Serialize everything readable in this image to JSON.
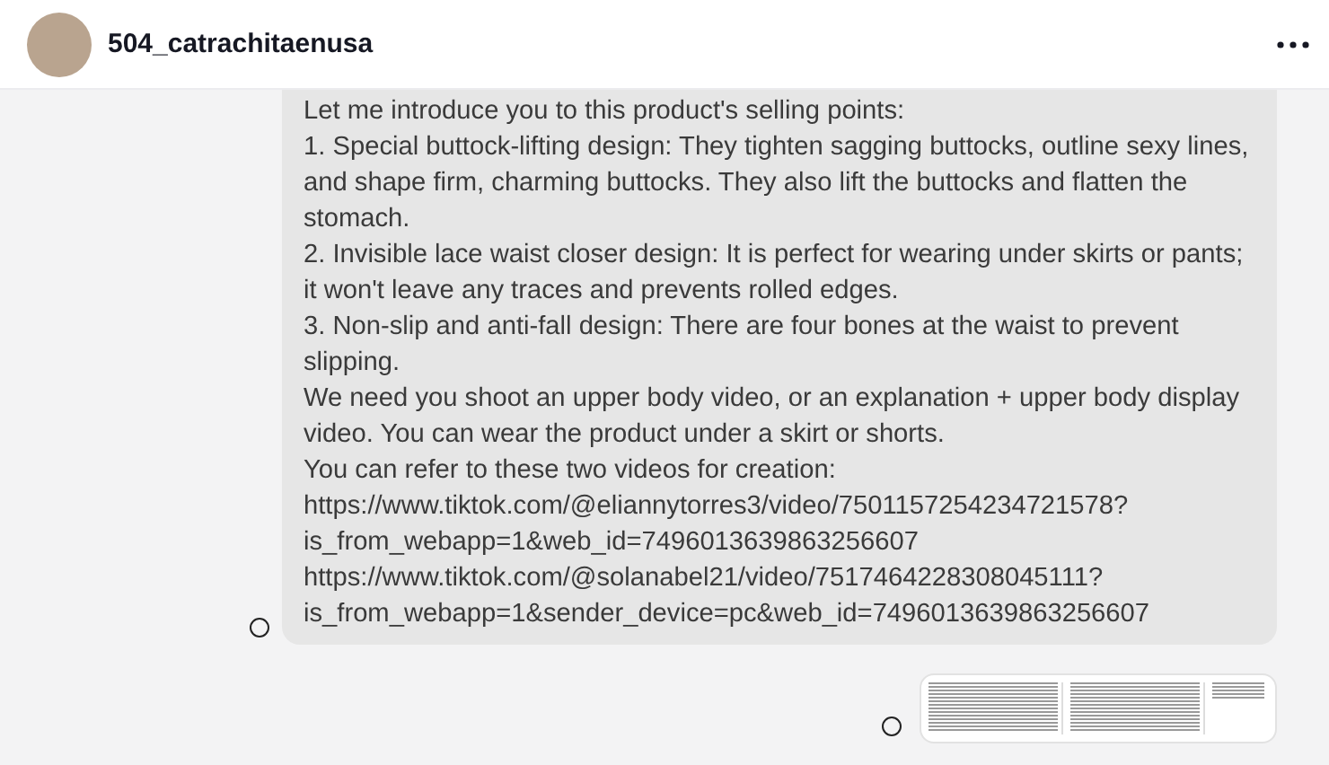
{
  "header": {
    "username": "504_catrachitaenusa"
  },
  "messages": [
    {
      "kind": "text",
      "selected": false,
      "paragraphs": [
        "Let me introduce you to this product's selling points:",
        "1. Special buttock-lifting design: They tighten sagging buttocks, outline sexy lines, and shape firm, charming buttocks. They also lift the buttocks and flatten the stomach.",
        "2. Invisible lace waist closer design: It is perfect for wearing under skirts or pants; it won't leave any traces and prevents rolled edges.",
        "3. Non-slip and anti-fall design: There are four bones at the waist to prevent slipping.",
        "We need you shoot an upper body video, or an explanation + upper body display video.  You can wear the product under a skirt or shorts.",
        "You can refer to these two videos for creation:",
        " https://www.tiktok.com/@eliannytorres3/video/7501157254234721578?is_from_webapp=1&web_id=7496013639863256607",
        "https://www.tiktok.com/@solanabel21/video/7517464228308045111?is_from_webapp=1&sender_device=pc&web_id=7496013639863256607"
      ]
    },
    {
      "kind": "image",
      "selected": false
    }
  ]
}
